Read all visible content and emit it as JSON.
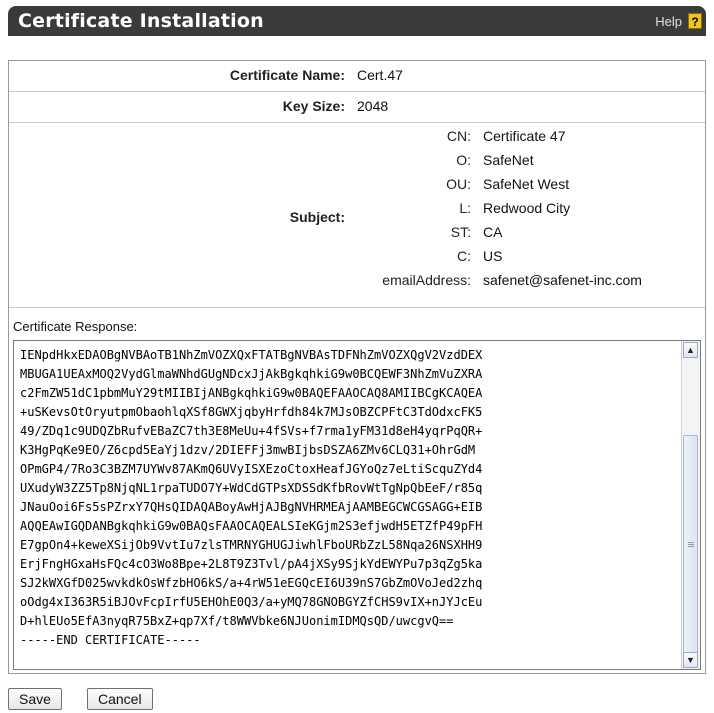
{
  "header": {
    "title": "Certificate Installation",
    "help_label": "Help",
    "help_icon": "help-icon"
  },
  "fields": {
    "cert_name_label": "Certificate Name:",
    "cert_name_value": "Cert.47",
    "key_size_label": "Key Size:",
    "key_size_value": "2048",
    "subject_label": "Subject:"
  },
  "subject": [
    {
      "key": "CN:",
      "value": "Certificate 47"
    },
    {
      "key": "O:",
      "value": "SafeNet"
    },
    {
      "key": "OU:",
      "value": "SafeNet West"
    },
    {
      "key": "L:",
      "value": "Redwood City"
    },
    {
      "key": "ST:",
      "value": "CA"
    },
    {
      "key": "C:",
      "value": "US"
    },
    {
      "key": "emailAddress:",
      "value": "safenet@safenet-inc.com"
    }
  ],
  "response": {
    "label": "Certificate Response:",
    "text": "IENpdHkxEDAOBgNVBAoTB1NhZmVOZXQxFTATBgNVBAsTDFNhZmVOZXQgV2VzdDEX\nMBUGA1UEAxMOQ2VydGlmaWNhdGUgNDcxJjAkBgkqhkiG9w0BCQEWF3NhZmVuZXRA\nc2FmZW51dC1pbmMuY29tMIIBIjANBgkqhkiG9w0BAQEFAAOCAQ8AMIIBCgKCAQEA\n+uSKevsOtOryutpmObaohlqXSf8GWXjqbyHrfdh84k7MJsOBZCPFtC3TdOdxcFK5\n49/ZDq1c9UDQZbRufvEBaZC7th3E8MeUu+4fSVs+f7rma1yFM31d8eH4yqrPqQR+\nK3HgPqKe9EO/Z6cpd5EaYj1dzv/2DIEFFj3mwBIjbsDSZA6ZMv6CLQ31+OhrGdM\nOPmGP4/7Ro3C3BZM7UYWv87AKmQ6UVyISXEzoCtoxHeafJGYoQz7eLtiScquZYd4\nUXudyW3ZZ5Tp8NjqNL1rpaTUDO7Y+WdCdGTPsXDSSdKfbRovWtTgNpQbEeF/r85q\nJNauOoi6Fs5sPZrxY7QHsQIDAQABoyAwHjAJBgNVHRMEAjAAMBEGCWCGSAGG+EIB\nAQQEAwIGQDANBgkqhkiG9w0BAQsFAAOCAQEALSIeKGjm2S3efjwdH5ETZfP49pFH\nE7gpOn4+keweXSijOb9VvtIu7zlsTMRNYGHUGJiwhlFboURbZzL58Nqa26NSXHH9\nErjFngHGxaHsFQc4cO3Wo8Bpe+2L8T9Z3Tvl/pA4jXSy9SjkYdEWYPu7p3qZg5ka\nSJ2kWXGfD025wvkdkOsWfzbHO6kS/a+4rW51eEGQcEI6U39nS7GbZmOVoJed2zhq\noOdg4xI363R5iBJOvFcpIrfU5EHOhE0Q3/a+yMQ78GNOBGYZfCHS9vIX+nJYJcEu\nD+hlEUo5EfA3nyqR75BxZ+qp7Xf/t8WWVbke6NJUonimIDMQsQD/uwcgvQ==\n-----END CERTIFICATE-----"
  },
  "buttons": {
    "save": "Save",
    "cancel": "Cancel"
  }
}
